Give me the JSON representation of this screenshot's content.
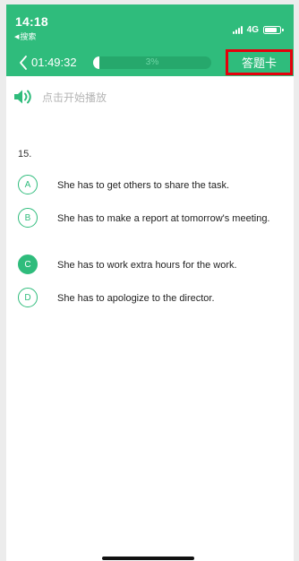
{
  "status_bar": {
    "time": "14:18",
    "back_app": "搜索",
    "network": "4G"
  },
  "nav": {
    "timer": "01:49:32",
    "progress_percent": 3,
    "progress_label": "3%",
    "answer_card_label": "答题卡"
  },
  "audio": {
    "play_label": "点击开始播放"
  },
  "question": {
    "number": "15.",
    "options": [
      {
        "letter": "A",
        "text": "She has to get others to share the task.",
        "selected": false
      },
      {
        "letter": "B",
        "text": "She has to make a report at tomorrow's meeting.",
        "selected": false
      },
      {
        "letter": "C",
        "text": "She has to work extra hours for the work.",
        "selected": true
      },
      {
        "letter": "D",
        "text": "She has to apologize to the director.",
        "selected": false
      }
    ]
  },
  "colors": {
    "brand_green": "#2fbc7c",
    "highlight_red": "#e5000c"
  }
}
